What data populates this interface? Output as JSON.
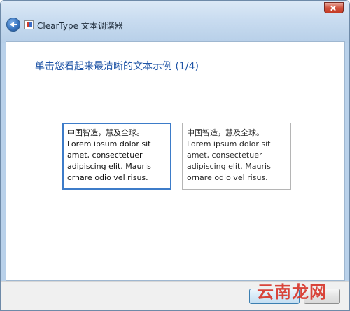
{
  "window": {
    "title": "ClearType 文本调谐器"
  },
  "icons": {
    "back": "back-arrow-icon",
    "app": "cleartype-app-icon",
    "close": "close-icon"
  },
  "page": {
    "instruction": "单击您看起来最清晰的文本示例 (1/4)"
  },
  "samples": [
    {
      "lines": [
        "中国智造，慧及全球。",
        "Lorem ipsum dolor sit",
        "amet, consectetuer",
        "adipiscing elit. Mauris",
        "ornare odio vel risus."
      ],
      "selected": true
    },
    {
      "lines": [
        "中国智造，慧及全球。",
        "Lorem ipsum dolor sit",
        "amet, consectetuer",
        "adipiscing elit. Mauris",
        "ornare odio vel risus."
      ],
      "selected": false
    }
  ],
  "buttons": {
    "next": "",
    "cancel": ""
  },
  "watermark": "云南龙网",
  "colors": {
    "instruction": "#1f54a6",
    "selected_border": "#3d7cc9",
    "watermark": "#d8362b"
  }
}
